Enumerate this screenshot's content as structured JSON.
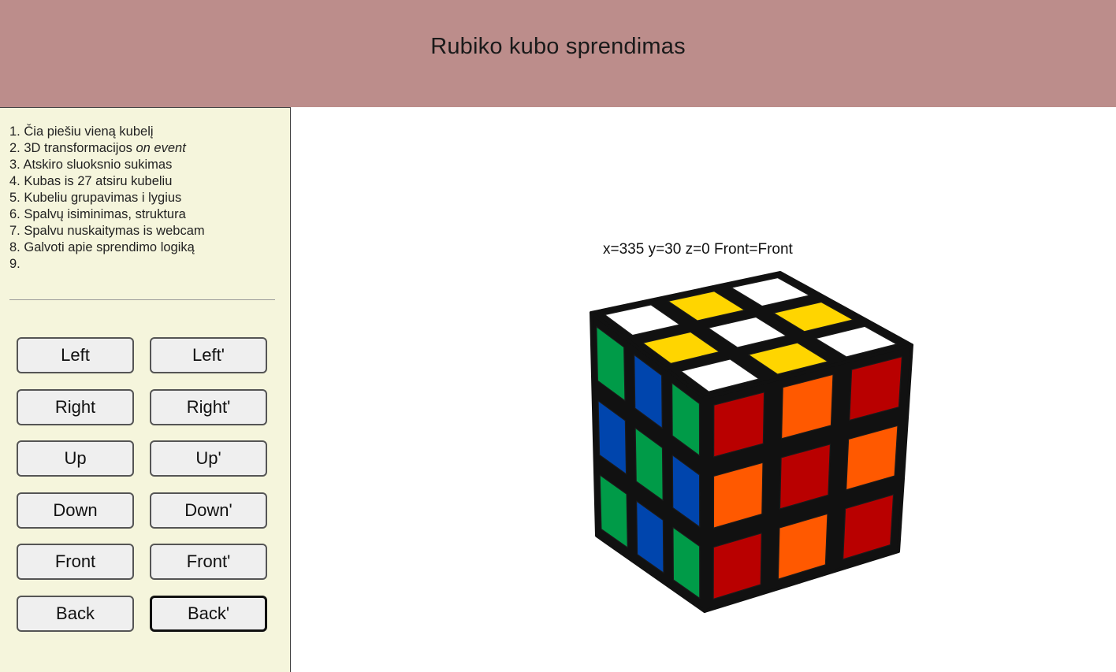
{
  "app": {
    "title": "Rubiko kubo sprendimas"
  },
  "todo": [
    {
      "num": "1.",
      "text": "Čia piešiu vieną kubelį",
      "em": ""
    },
    {
      "num": "2.",
      "text": "3D transformacijos ",
      "em": "on event"
    },
    {
      "num": "3.",
      "text": "Atskiro sluoksnio sukimas",
      "em": ""
    },
    {
      "num": "4.",
      "text": "Kubas is 27 atsiru kubeliu",
      "em": ""
    },
    {
      "num": "5.",
      "text": "Kubeliu grupavimas i lygius",
      "em": ""
    },
    {
      "num": "6.",
      "text": "Spalvų isiminimas, struktura",
      "em": ""
    },
    {
      "num": "7.",
      "text": "Spalvu nuskaitymas is webcam",
      "em": ""
    },
    {
      "num": "8.",
      "text": "Galvoti apie sprendimo logiką",
      "em": ""
    },
    {
      "num": "9.",
      "text": "",
      "em": ""
    }
  ],
  "controls": {
    "left": "Left",
    "left_prime": "Left'",
    "right": "Right",
    "right_prime": "Right'",
    "up": "Up",
    "up_prime": "Up'",
    "down": "Down",
    "down_prime": "Down'",
    "front": "Front",
    "front_prime": "Front'",
    "back": "Back",
    "back_prime": "Back'"
  },
  "status": {
    "orientation_text": "x=335 y=30 z=0 Front=Front"
  },
  "cube": {
    "colors": {
      "white": "#ffffff",
      "yellow": "#ffd500",
      "red": "#b90000",
      "orange": "#ff5900",
      "blue": "#0045ad",
      "green": "#009b48",
      "body": "#111111"
    },
    "top": [
      [
        "white",
        "yellow",
        "white"
      ],
      [
        "yellow",
        "white",
        "yellow"
      ],
      [
        "white",
        "yellow",
        "white"
      ]
    ],
    "front": [
      [
        "red",
        "orange",
        "red"
      ],
      [
        "orange",
        "red",
        "orange"
      ],
      [
        "red",
        "orange",
        "red"
      ]
    ],
    "left": [
      [
        "green",
        "blue",
        "green"
      ],
      [
        "blue",
        "green",
        "blue"
      ],
      [
        "green",
        "blue",
        "green"
      ]
    ]
  }
}
